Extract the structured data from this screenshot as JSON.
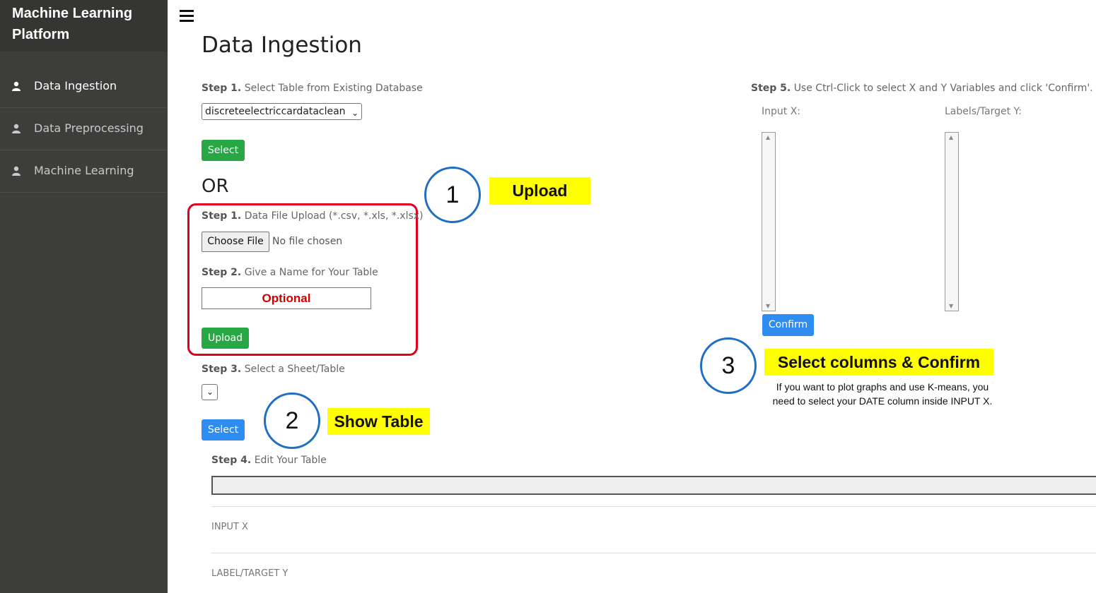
{
  "sidebar": {
    "brand_line1": "Machine Learning",
    "brand_line2": "Platform",
    "items": [
      {
        "label": "Data Ingestion",
        "icon": "user-icon"
      },
      {
        "label": "Data Preprocessing",
        "icon": "user-icon"
      },
      {
        "label": "Machine Learning",
        "icon": "user-icon"
      }
    ]
  },
  "header": {
    "menu_icon": "hamburger-menu-icon",
    "title": "Data Ingestion"
  },
  "step1_db": {
    "step": "Step 1.",
    "text": "Select Table from Existing Database",
    "selected_table": "discreteelectriccardataclean",
    "button": "Select"
  },
  "or_text": "OR",
  "upload": {
    "step1": "Step 1.",
    "step1_text": "Data File Upload (*.csv, *.xls, *.xlsx)",
    "choose_file": "Choose File",
    "file_status": "No file chosen",
    "step2": "Step 2.",
    "step2_text": "Give a Name for Your Table",
    "name_placeholder": "Optional",
    "button": "Upload"
  },
  "step3": {
    "step": "Step 3.",
    "text": "Select a Sheet/Table",
    "selected": "",
    "button": "Select"
  },
  "step4": {
    "step": "Step 4.",
    "text": "Edit Your Table",
    "input_x": "INPUT X",
    "label_y": "LABEL/TARGET Y"
  },
  "step5": {
    "step": "Step 5.",
    "text": "Use Ctrl-Click to select X and Y Variables and click 'Confirm'.",
    "input_x_label": "Input X:",
    "target_y_label": "Labels/Target Y:",
    "button": "Confirm"
  },
  "annotations": {
    "circle1": "1",
    "tag1": "Upload",
    "circle2": "2",
    "tag2": "Show Table",
    "circle3": "3",
    "tag3": "Select columns & Confirm",
    "note_line1": "If you want to plot graphs and use K-means, you",
    "note_line2": "need to select your DATE column inside INPUT X."
  },
  "colors": {
    "sidebar_bg": "#3d3d3b",
    "green_button": "#28a745",
    "blue_button": "#2f8cf0",
    "highlight_red": "#e0001b",
    "tag_yellow": "#ffff00",
    "circle_blue": "#1f6fc4"
  }
}
